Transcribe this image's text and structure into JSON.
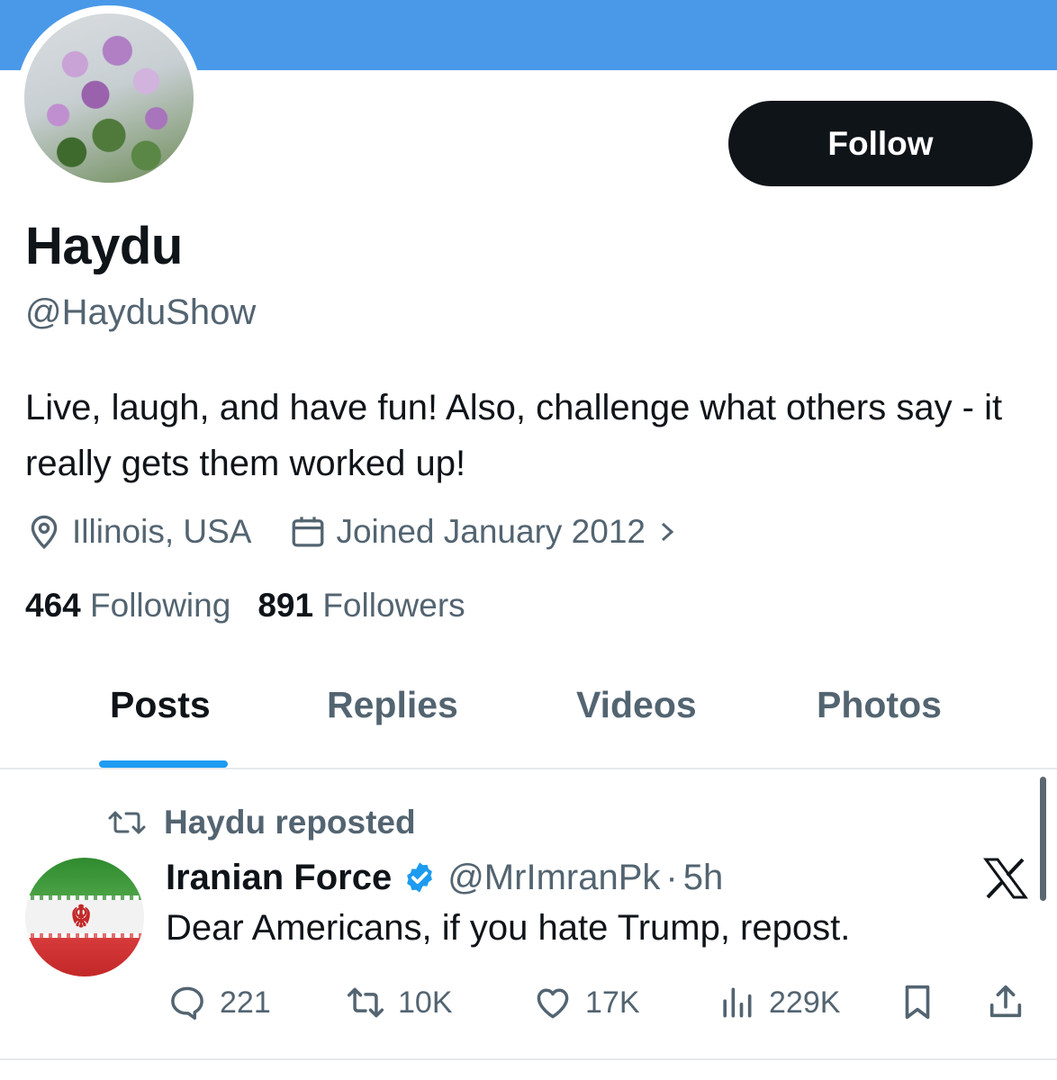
{
  "colors": {
    "banner": "#4a99e9",
    "accent": "#1d9bf0",
    "text_primary": "#0f1419",
    "text_secondary": "#536471",
    "button_bg": "#0f1419"
  },
  "profile": {
    "display_name": "Haydu",
    "handle": "@HayduShow",
    "bio": "Live, laugh, and have fun! Also, challenge what others say - it really gets them worked up!",
    "location": "Illinois, USA",
    "joined": "Joined January 2012",
    "following_count": "464",
    "following_label": "Following",
    "followers_count": "891",
    "followers_label": "Followers",
    "follow_button": "Follow",
    "avatar_icon": "lilac-flowers-photo"
  },
  "tabs": [
    {
      "label": "Posts",
      "active": true
    },
    {
      "label": "Replies",
      "active": false
    },
    {
      "label": "Videos",
      "active": false
    },
    {
      "label": "Photos",
      "active": false
    }
  ],
  "post": {
    "repost_label": "Haydu reposted",
    "author": "Iranian Force",
    "author_handle": "@MrImranPk",
    "separator": "·",
    "time": "5h",
    "text": "Dear Americans, if you hate Trump, repost.",
    "avatar_icon": "iran-flag-avatar",
    "verified_icon": "verified-badge-icon",
    "stats": {
      "replies": "221",
      "reposts": "10K",
      "likes": "17K",
      "views": "229K"
    }
  }
}
